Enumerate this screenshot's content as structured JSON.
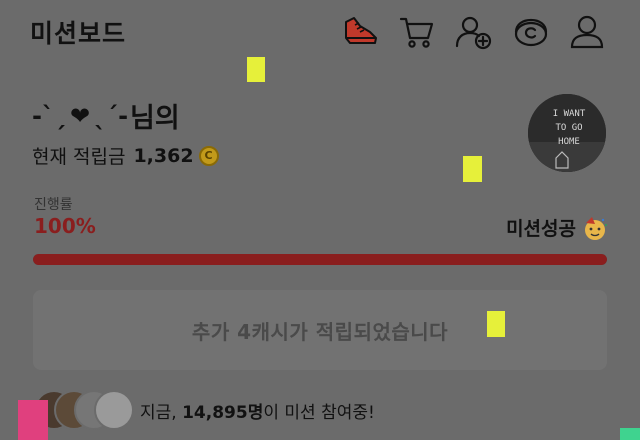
{
  "header": {
    "title": "미션보드",
    "icons": [
      "sneaker-icon",
      "cart-icon",
      "add-friend-icon",
      "coin-c-icon",
      "user-icon"
    ]
  },
  "profile": {
    "nick_deco_left": "-ˋˏ",
    "nick_heart": "❤",
    "nick_deco_right": "ˎˊ-",
    "nick_suffix": "님의",
    "points_label": "현재 적립금",
    "points_value": "1,362",
    "coin_symbol": "C",
    "avatar_text": [
      "I WANT",
      "TO GO",
      "HOME"
    ]
  },
  "progress": {
    "label": "진행률",
    "value_text": "100%",
    "fraction": 1.0,
    "status": "미션성공"
  },
  "reward": {
    "text": "추가 4캐시가 적립되었습니다"
  },
  "participants": {
    "prefix": "지금, ",
    "count": "14,895명",
    "suffix": "이 미션 참여중!"
  },
  "colors": {
    "accent": "#8a1e1e",
    "background": "#6b6b6b",
    "marker_yellow": "#e6f03a",
    "marker_pink": "#e0407e",
    "marker_green": "#3fd38f"
  }
}
